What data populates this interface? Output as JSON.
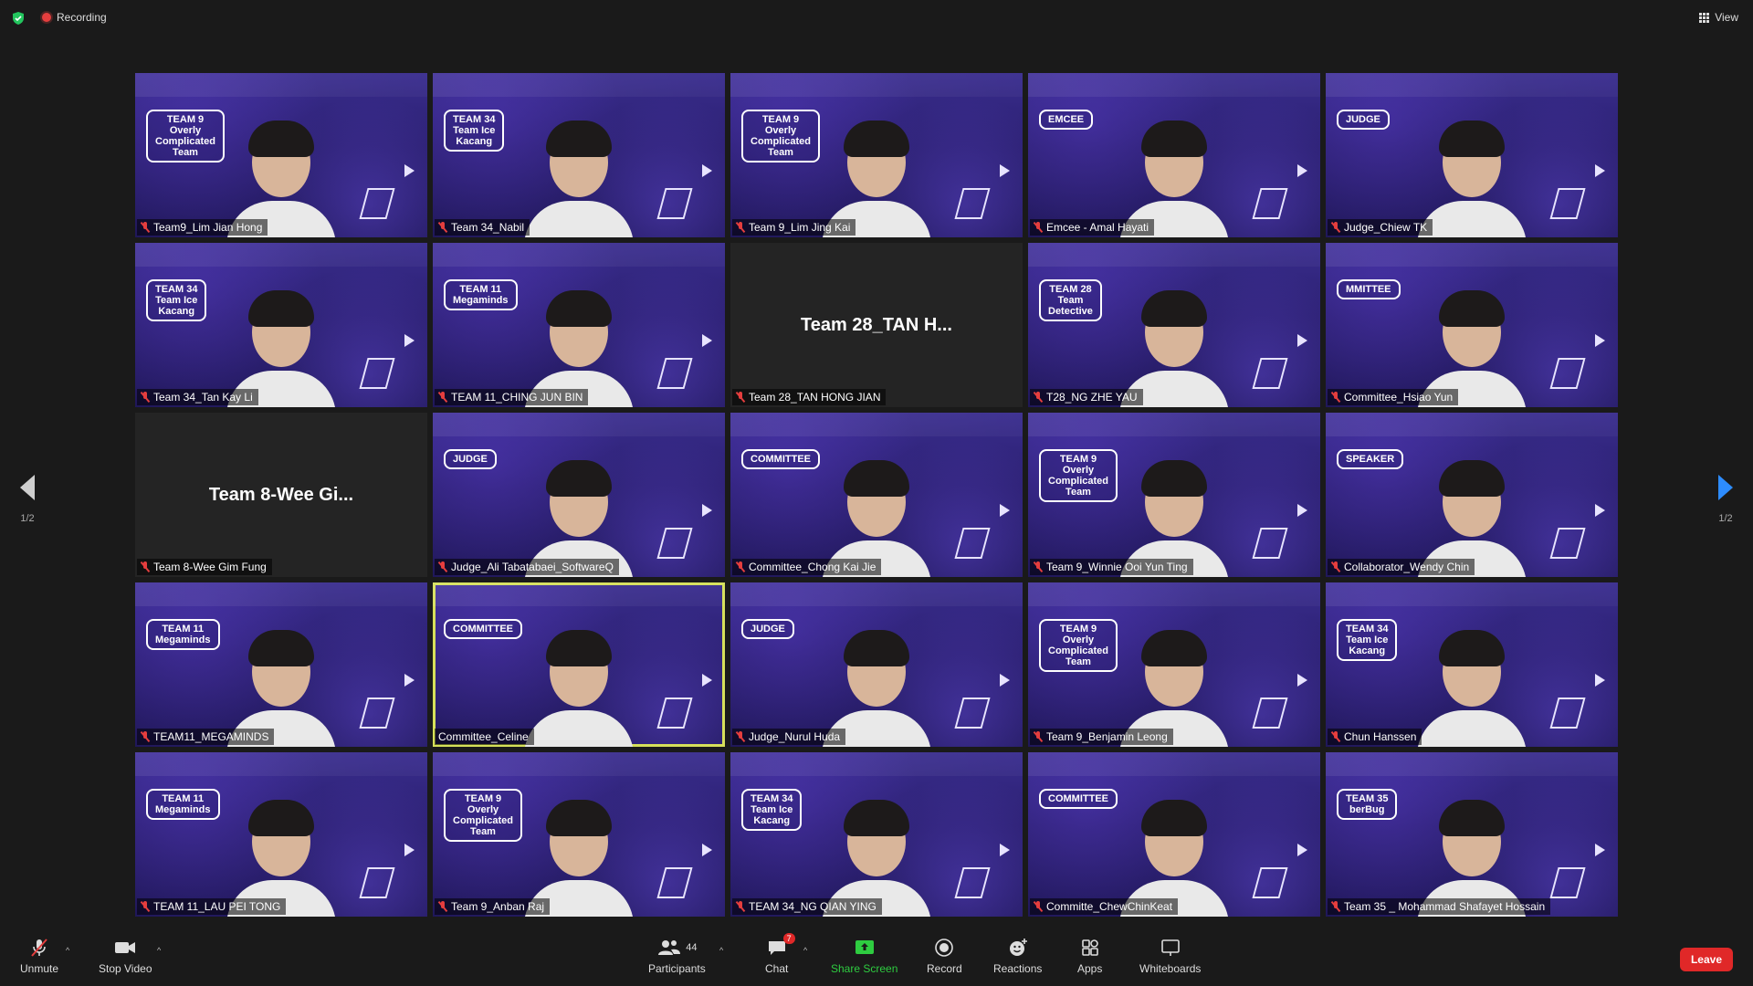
{
  "topbar": {
    "recording_label": "Recording",
    "view_label": "View"
  },
  "pager": {
    "left_page": "1/2",
    "right_page": "1/2"
  },
  "tiles": [
    {
      "name": "Team9_Lim Jian Hong",
      "badge": "TEAM 9\nOverly\nComplicated\nTeam",
      "video": true,
      "muted": true
    },
    {
      "name": "Team 34_Nabil",
      "badge": "TEAM 34\nTeam Ice\nKacang",
      "video": true,
      "muted": true
    },
    {
      "name": "Team 9_Lim Jing Kai",
      "badge": "TEAM 9\nOverly\nComplicated\nTeam",
      "video": true,
      "muted": true
    },
    {
      "name": "Emcee - Amal Hayati",
      "badge": "EMCEE",
      "video": true,
      "muted": true
    },
    {
      "name": "Judge_Chiew TK",
      "badge": "JUDGE",
      "video": true,
      "muted": true
    },
    {
      "name": "Team 34_Tan Kay Li",
      "badge": "TEAM 34\nTeam Ice\nKacang",
      "video": true,
      "muted": true
    },
    {
      "name": "TEAM 11_CHING JUN BIN",
      "badge": "TEAM 11\nMegaminds",
      "video": true,
      "muted": true
    },
    {
      "name": "Team 28_TAN HONG JIAN",
      "display": "Team 28_TAN H...",
      "video": false,
      "muted": true
    },
    {
      "name": "T28_NG ZHE YAU",
      "badge": "TEAM 28\nTeam\nDetective",
      "video": true,
      "muted": true
    },
    {
      "name": "Committee_Hsiao Yun",
      "badge": "MMITTEE",
      "video": true,
      "muted": true
    },
    {
      "name": "Team 8-Wee Gim Fung",
      "display": "Team 8-Wee Gi...",
      "video": false,
      "muted": true
    },
    {
      "name": "Judge_Ali Tabatabaei_SoftwareQ",
      "badge": "JUDGE",
      "video": true,
      "muted": true
    },
    {
      "name": "Committee_Chong Kai Jie",
      "badge": "COMMITTEE",
      "video": true,
      "muted": true
    },
    {
      "name": "Team 9_Winnie Ooi Yun Ting",
      "badge": "TEAM 9\nOverly\nComplicated\nTeam",
      "video": true,
      "muted": true
    },
    {
      "name": "Collaborator_Wendy Chin",
      "badge": "SPEAKER",
      "video": true,
      "muted": true
    },
    {
      "name": "TEAM11_MEGAMINDS",
      "badge": "TEAM 11\nMegaminds",
      "video": true,
      "muted": true
    },
    {
      "name": "Committee_Celine",
      "badge": "COMMITTEE",
      "video": true,
      "muted": false,
      "active": true
    },
    {
      "name": "Judge_Nurul Huda",
      "badge": "JUDGE",
      "video": true,
      "muted": true
    },
    {
      "name": "Team 9_Benjamin Leong",
      "badge": "TEAM 9\nOverly\nComplicated\nTeam",
      "video": true,
      "muted": true
    },
    {
      "name": "Chun Hanssen",
      "badge": "TEAM 34\nTeam Ice\nKacang",
      "video": true,
      "muted": true
    },
    {
      "name": "TEAM 11_LAU PEI TONG",
      "badge": "TEAM 11\nMegaminds",
      "video": true,
      "muted": true
    },
    {
      "name": "Team 9_Anban Raj",
      "badge": "TEAM 9\nOverly\nComplicated\nTeam",
      "video": true,
      "muted": true
    },
    {
      "name": "TEAM 34_NG QIAN YING",
      "badge": "TEAM 34\nTeam Ice\nKacang",
      "video": true,
      "muted": true
    },
    {
      "name": "Committe_ChewChinKeat",
      "badge": "COMMITTEE",
      "video": true,
      "muted": true
    },
    {
      "name": "Team 35 _ Mohammad Shafayet Hossain",
      "badge": "TEAM 35\nberBug",
      "video": true,
      "muted": true
    }
  ],
  "toolbar": {
    "unmute": "Unmute",
    "stop_video": "Stop Video",
    "participants": "Participants",
    "participants_count": "44",
    "chat": "Chat",
    "chat_badge": "7",
    "share_screen": "Share Screen",
    "record": "Record",
    "reactions": "Reactions",
    "apps": "Apps",
    "whiteboards": "Whiteboards",
    "leave": "Leave"
  },
  "colors": {
    "accent_blue": "#2d8cff",
    "share_green": "#2ecc40",
    "leave_red": "#e02828",
    "active_speaker": "#d6e05a"
  }
}
